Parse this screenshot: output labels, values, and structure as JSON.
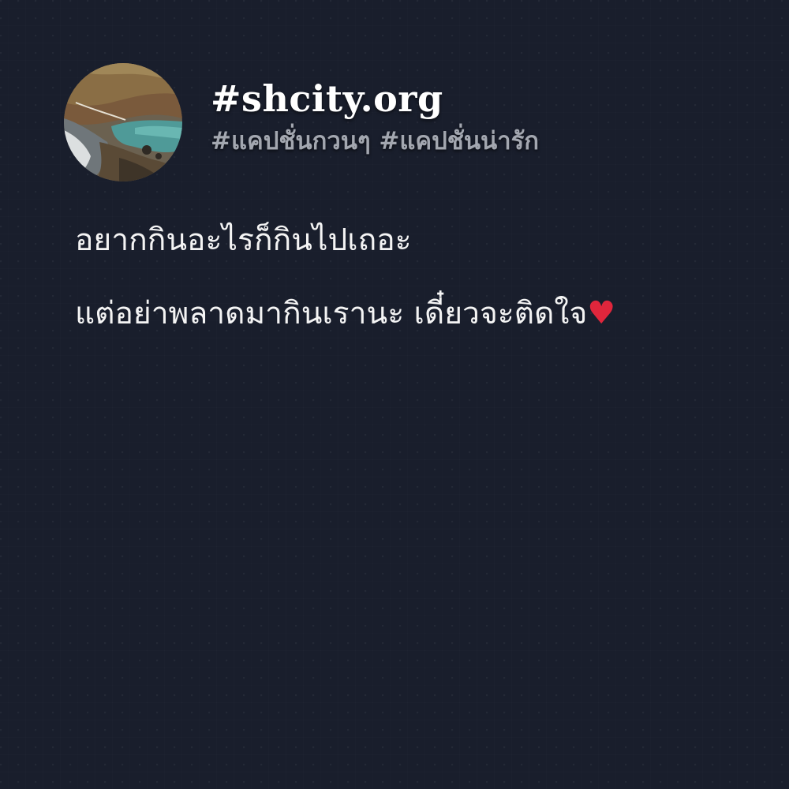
{
  "post": {
    "site_name": "#shcity.org",
    "hashtags": "#แคปชั่นกวนๆ #แคปชั่นน่ารัก",
    "caption_line_1": "อยากกินอะไรก็กินไปเถอะ",
    "caption_line_2": "แต่อย่าพลาดมากินเรานะ เดี๋ยวจะติดใจ",
    "heart_emoji": "♥"
  },
  "avatar": {
    "icon": "coastal-landscape-photo"
  },
  "colors": {
    "background": "#191e2c",
    "title_text": "#ffffff",
    "hashtag_text": "#a3a7b0",
    "caption_text": "#f4f4f4",
    "heart": "#e0263c"
  }
}
